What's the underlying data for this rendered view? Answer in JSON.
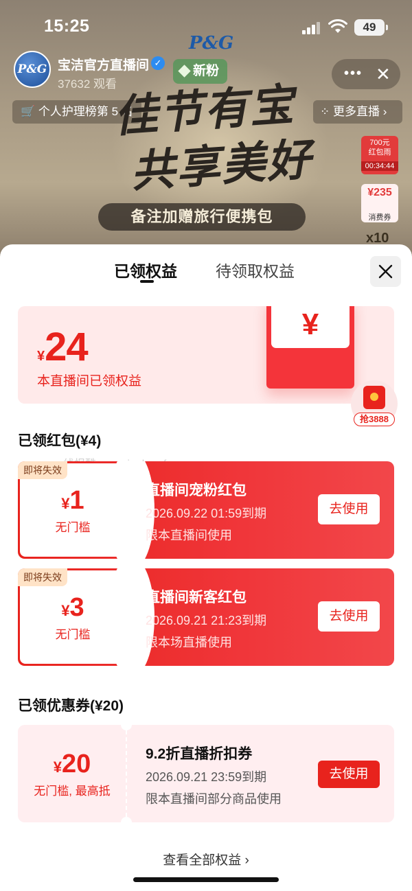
{
  "status_bar": {
    "time": "15:25",
    "battery": "49"
  },
  "live": {
    "brand_logo": "P&G",
    "anchor_avatar_text": "P&G",
    "anchor_name": "宝洁官方直播间",
    "viewers": "37632 观看",
    "new_fan": "新粉",
    "rank": "个人护理榜第 5 名",
    "more_live": "更多直播 ›",
    "hero_line1": "佳节有宝",
    "hero_line2": "共享美好",
    "banner": "备注加赠旅行便携包",
    "redrain_amount": "700元",
    "redrain_label": "红包雨",
    "redrain_timer": "00:34:44",
    "voucher_amount": "¥235",
    "voucher_label": "消费券",
    "side_count": "x10"
  },
  "sheet": {
    "tabs": [
      {
        "label": "已领权益",
        "active": true
      },
      {
        "label": "待领取权益",
        "active": false
      }
    ],
    "summary": {
      "currency": "¥",
      "amount": "24",
      "description": "本直播间已领权益"
    },
    "float_bubble": "抢3888",
    "watermark": "线报酷 new.xianbao.fun",
    "packets_title": "已领红包(¥4)",
    "packets": [
      {
        "tag": "即将失效",
        "currency": "¥",
        "value": "1",
        "condition": "无门槛",
        "title": "直播间宠粉红包",
        "expiry": "2026.09.22 01:59到期",
        "scope": "限本直播间使用",
        "button": "去使用"
      },
      {
        "tag": "即将失效",
        "currency": "¥",
        "value": "3",
        "condition": "无门槛",
        "title": "直播间新客红包",
        "expiry": "2026.09.21 21:23到期",
        "scope": "限本场直播使用",
        "button": "去使用"
      }
    ],
    "coupons_title": "已领优惠券(¥20)",
    "coupon": {
      "currency": "¥",
      "value": "20",
      "condition": "无门槛, 最高抵",
      "title": "9.2折直播折扣券",
      "expiry": "2026.09.21 23:59到期",
      "scope": "限本直播间部分商品使用",
      "button": "去使用"
    },
    "view_all": "查看全部权益 ›"
  },
  "colors": {
    "accent": "#e8231d",
    "summary_bg": "#ffeaea",
    "coupon_bg": "#ffeef0"
  }
}
